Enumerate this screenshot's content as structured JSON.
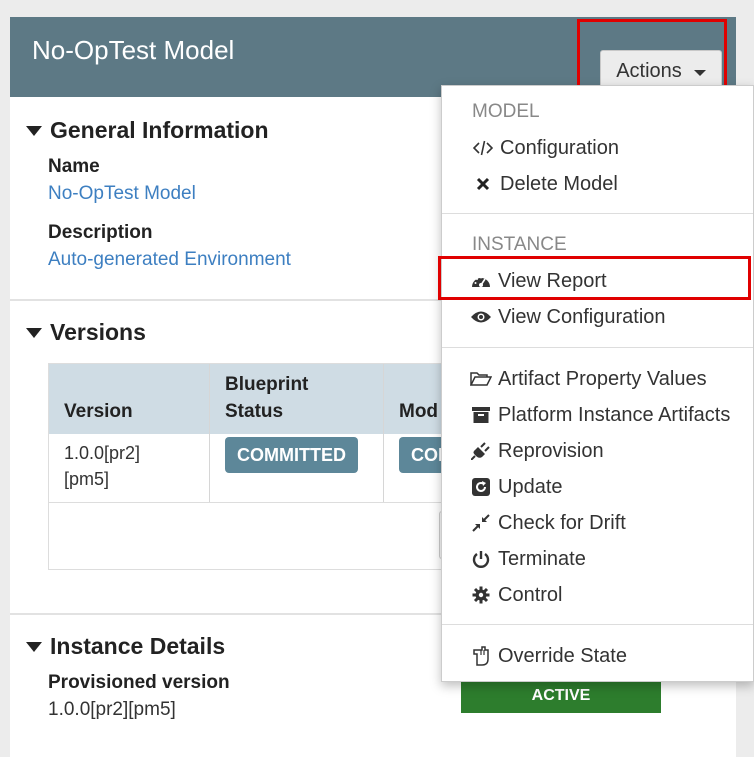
{
  "header": {
    "title": "No-OpTest Model",
    "actions_label": "Actions"
  },
  "general": {
    "title": "General Information",
    "name_label": "Name",
    "name_value": "No-OpTest Model",
    "description_label": "Description",
    "description_value": "Auto-generated Environment"
  },
  "versions": {
    "title": "Versions",
    "columns": [
      "Version",
      "Blueprint",
      "Status",
      "Mod"
    ],
    "row": {
      "version_line1": "1.0.0[pr2]",
      "version_line2": "[pm5]",
      "blueprint_status": "COMMITTED",
      "model_status": "COI"
    }
  },
  "instance": {
    "title": "Instance Details",
    "provisioned_label": "Provisioned version",
    "provisioned_value": "1.0.0[pr2][pm5]",
    "state_badge": "ACTIVE"
  },
  "dropdown": {
    "model_header": "MODEL",
    "instance_header": "INSTANCE",
    "items": [
      {
        "label": "Configuration",
        "icon": "code-icon"
      },
      {
        "label": "Delete Model",
        "icon": "times-icon"
      },
      {
        "label": "View Report",
        "icon": "dashboard-icon"
      },
      {
        "label": "View Configuration",
        "icon": "eye-icon"
      },
      {
        "label": "Artifact Property Values",
        "icon": "folder-open-icon"
      },
      {
        "label": "Platform Instance Artifacts",
        "icon": "archive-icon"
      },
      {
        "label": "Reprovision",
        "icon": "plug-icon"
      },
      {
        "label": "Update",
        "icon": "refresh-square-icon"
      },
      {
        "label": "Check for Drift",
        "icon": "compress-icon"
      },
      {
        "label": "Terminate",
        "icon": "power-icon"
      },
      {
        "label": "Control",
        "icon": "gear-icon"
      },
      {
        "label": "Override State",
        "icon": "hand-icon"
      }
    ]
  },
  "colors": {
    "header_bg": "#5d7985",
    "badge_blue": "#5d8799",
    "badge_green": "#2d7d2d",
    "link": "#3d7fc1",
    "highlight": "#e00000"
  }
}
